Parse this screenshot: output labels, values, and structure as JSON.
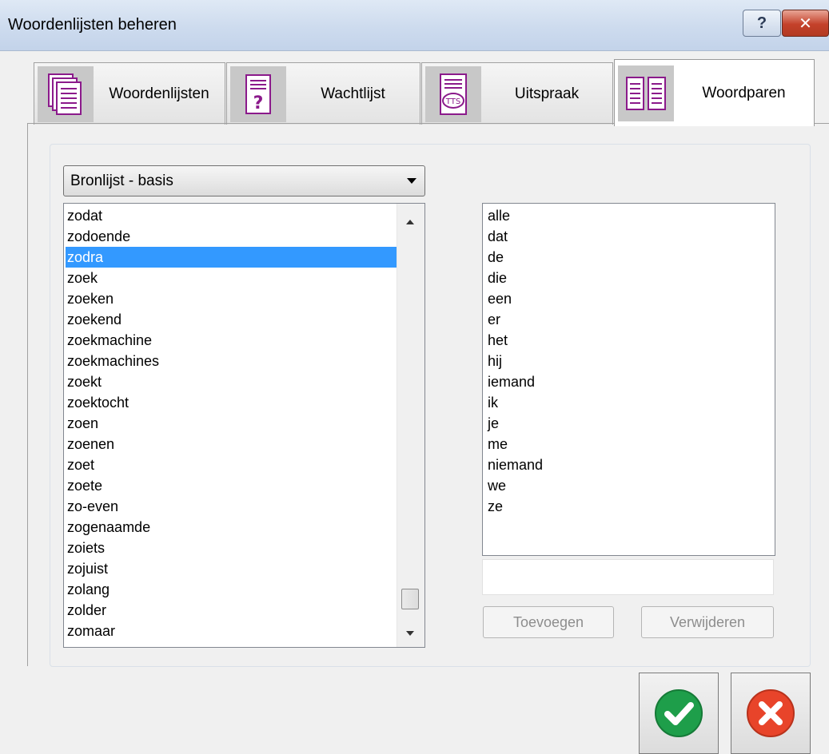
{
  "window": {
    "title": "Woordenlijsten beheren",
    "help_label": "?",
    "close_label": "✕"
  },
  "tabs": [
    {
      "label": "Woordenlijsten",
      "icon": "document-list-icon"
    },
    {
      "label": "Wachtlijst",
      "icon": "question-document-icon"
    },
    {
      "label": "Uitspraak",
      "icon": "tts-document-icon"
    },
    {
      "label": "Woordparen",
      "icon": "word-pairs-icon",
      "active": true
    }
  ],
  "source_list": {
    "selected": "Bronlijst - basis",
    "items": [
      "zodat",
      "zodoende",
      "zodra",
      "zoek",
      "zoeken",
      "zoekend",
      "zoekmachine",
      "zoekmachines",
      "zoekt",
      "zoektocht",
      "zoen",
      "zoenen",
      "zoet",
      "zoete",
      "zo-even",
      "zogenaamde",
      "zoiets",
      "zojuist",
      "zolang",
      "zolder",
      "zomaar"
    ],
    "selected_item": "zodra"
  },
  "pair_list": {
    "items": [
      "alle",
      "dat",
      "de",
      "die",
      "een",
      "er",
      "het",
      "hij",
      "iemand",
      "ik",
      "je",
      "me",
      "niemand",
      "we",
      "ze"
    ]
  },
  "input": {
    "value": ""
  },
  "buttons": {
    "add": "Toevoegen",
    "remove": "Verwijderen",
    "ok_icon": "checkmark-icon",
    "cancel_icon": "cancel-x-icon"
  },
  "colors": {
    "selection": "#3399ff",
    "tab_icon": "#8b1a8b",
    "ok": "#1e9e4a",
    "cancel": "#e8442a"
  }
}
